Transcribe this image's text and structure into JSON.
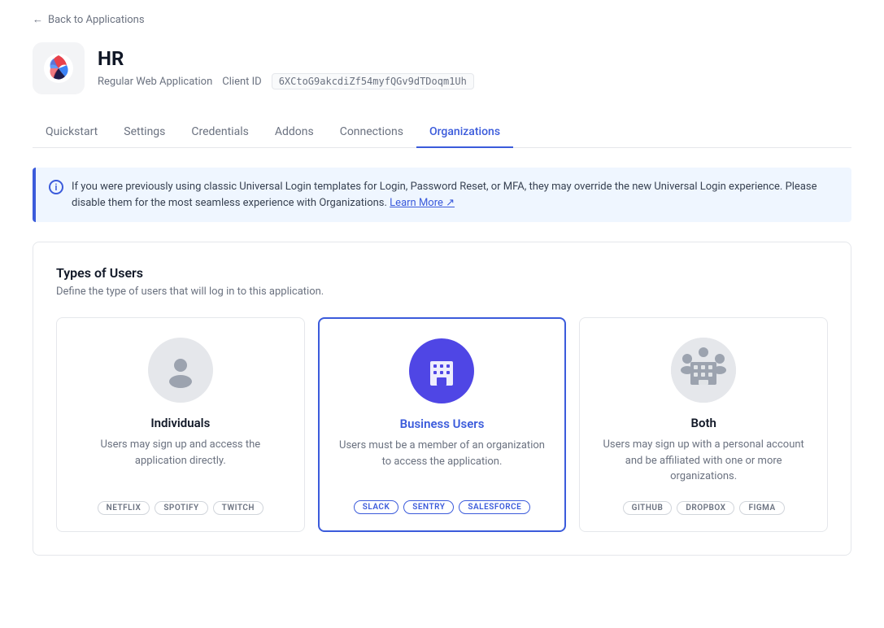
{
  "back_link": "Back to Applications",
  "app": {
    "name": "HR",
    "type": "Regular Web Application",
    "client_id_label": "Client ID",
    "client_id_value": "6XCtoG9akcdiZf54myfQGv9dTDoqm1Uh"
  },
  "tabs": [
    {
      "id": "quickstart",
      "label": "Quickstart",
      "active": false
    },
    {
      "id": "settings",
      "label": "Settings",
      "active": false
    },
    {
      "id": "credentials",
      "label": "Credentials",
      "active": false
    },
    {
      "id": "addons",
      "label": "Addons",
      "active": false
    },
    {
      "id": "connections",
      "label": "Connections",
      "active": false
    },
    {
      "id": "organizations",
      "label": "Organizations",
      "active": true
    }
  ],
  "banner": {
    "text": "If you were previously using classic Universal Login templates for Login, Password Reset, or MFA, they may override the new Universal Login experience. Please disable them for the most seamless experience with Organizations.",
    "link_text": "Learn More",
    "link_href": "#"
  },
  "types_section": {
    "title": "Types of Users",
    "subtitle": "Define the type of users that will log in to this application.",
    "options": [
      {
        "id": "individuals",
        "name": "Individuals",
        "description": "Users may sign up and access the application directly.",
        "selected": false,
        "tags": [
          "NETFLIX",
          "SPOTIFY",
          "TWITCH"
        ]
      },
      {
        "id": "business-users",
        "name": "Business Users",
        "description": "Users must be a member of an organization to access the application.",
        "selected": true,
        "tags": [
          "SLACK",
          "SENTRY",
          "SALESFORCE"
        ]
      },
      {
        "id": "both",
        "name": "Both",
        "description": "Users may sign up with a personal account and be affiliated with one or more organizations.",
        "selected": false,
        "tags": [
          "GITHUB",
          "DROPBOX",
          "FIGMA"
        ]
      }
    ]
  }
}
